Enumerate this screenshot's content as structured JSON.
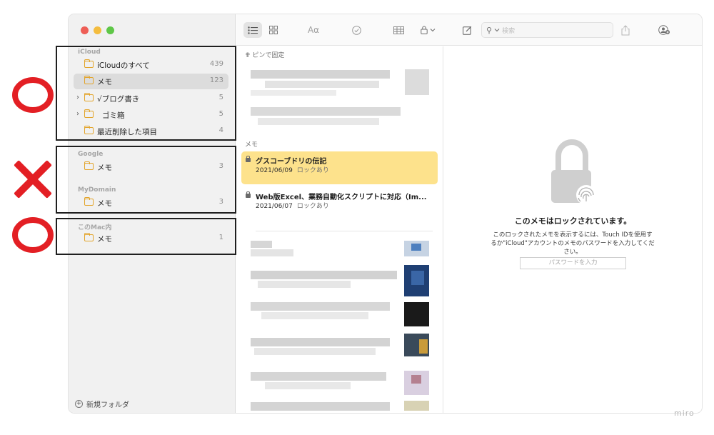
{
  "sidebar": {
    "groups": [
      {
        "name": "iCloud",
        "items": [
          {
            "label": "iCloudのすべて",
            "count": "439"
          },
          {
            "label": "メモ",
            "count": "123"
          },
          {
            "label": "√ブログ書き",
            "count": "5"
          },
          {
            "label": "ゴミ箱",
            "count": "5"
          },
          {
            "label": "最近削除した項目",
            "count": "4"
          }
        ]
      },
      {
        "name": "Google",
        "items": [
          {
            "label": "メモ",
            "count": "3"
          }
        ]
      },
      {
        "name": "MyDomain",
        "items": [
          {
            "label": "メモ",
            "count": "3"
          }
        ]
      },
      {
        "name": "このMac内",
        "items": [
          {
            "label": "メモ",
            "count": "1"
          }
        ]
      }
    ],
    "new_folder": "新規フォルダ"
  },
  "toolbar": {
    "search_placeholder": "検索",
    "font_label": "Aα"
  },
  "notelist": {
    "pinned_header": "ピンで固定",
    "section_header": "メモ",
    "notes": [
      {
        "title": "グスコーブドリの伝記",
        "date": "2021/06/09",
        "status": "ロックあり"
      },
      {
        "title": "Web版Excel、業務自動化スクリプトに対応（Im...",
        "date": "2021/06/07",
        "status": "ロックあり"
      }
    ]
  },
  "detail": {
    "title": "このメモはロックされています。",
    "message": "このロックされたメモを表示するには、Touch IDを使用するか\"iCloud\"アカウントのメモのパスワードを入力してください。",
    "password_placeholder": "パスワードを入力"
  },
  "watermark": "miro",
  "colors": {
    "annotation_red": "#e31f24",
    "selected_note": "#fde28c",
    "folder": "#e3a52c"
  }
}
